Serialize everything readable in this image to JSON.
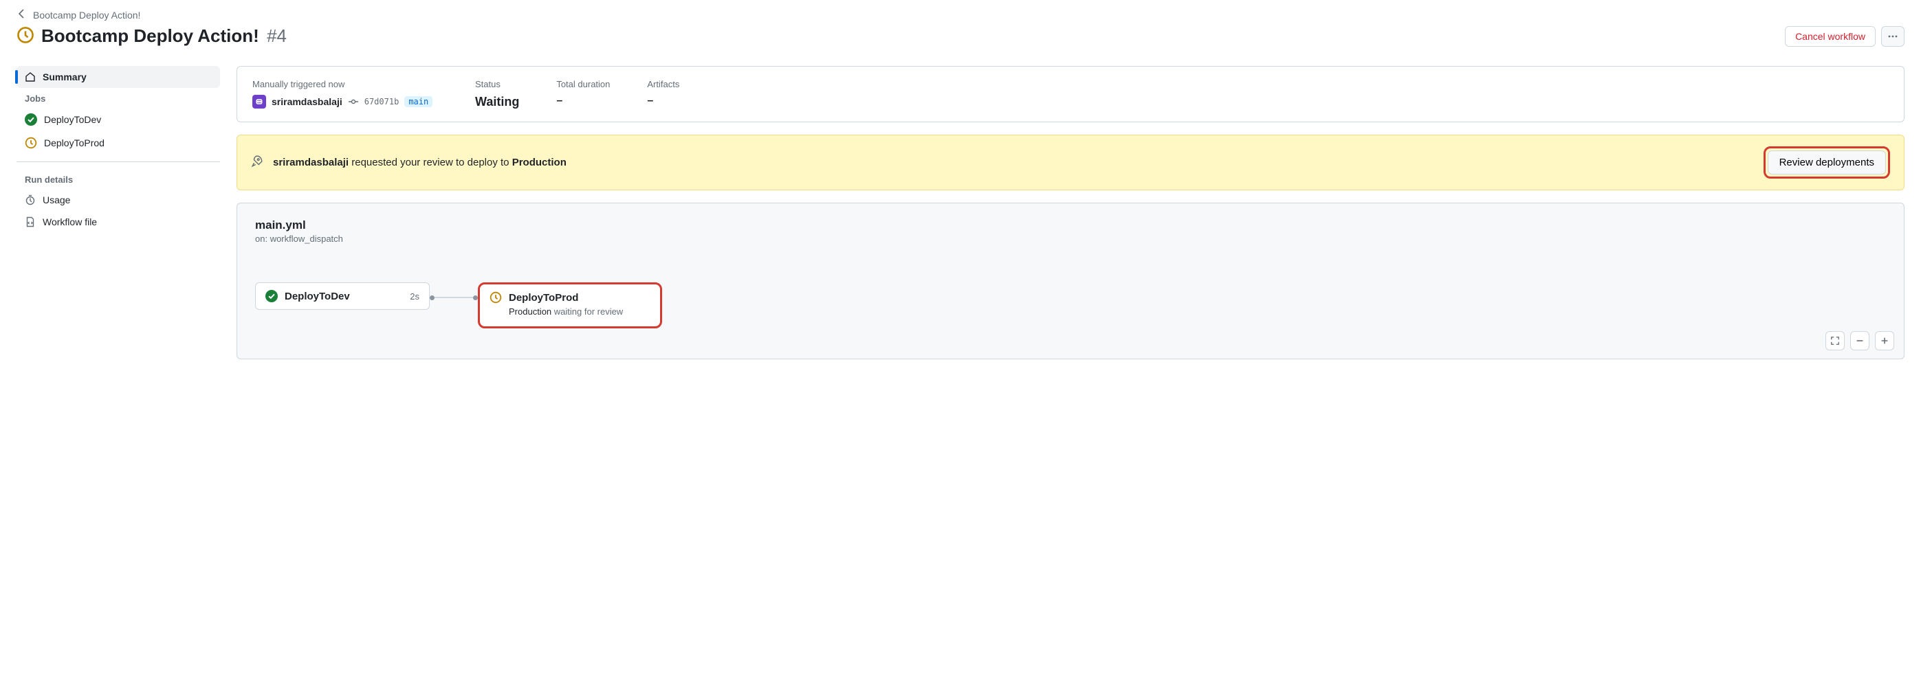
{
  "breadcrumb": {
    "text": "Bootcamp Deploy Action!"
  },
  "title": {
    "name": "Bootcamp Deploy Action!",
    "run_number": "#4"
  },
  "actions": {
    "cancel": "Cancel workflow"
  },
  "sidebar": {
    "summary": "Summary",
    "jobs_header": "Jobs",
    "jobs": [
      {
        "name": "DeployToDev",
        "status": "success"
      },
      {
        "name": "DeployToProd",
        "status": "waiting"
      }
    ],
    "run_details_header": "Run details",
    "usage": "Usage",
    "workflow_file": "Workflow file"
  },
  "summary": {
    "trigger_label": "Manually triggered now",
    "actor": "sriramdasbalaji",
    "commit": "67d071b",
    "branch": "main",
    "status_label": "Status",
    "status_value": "Waiting",
    "duration_label": "Total duration",
    "duration_value": "–",
    "artifacts_label": "Artifacts",
    "artifacts_value": "–"
  },
  "banner": {
    "actor": "sriramdasbalaji",
    "middle": " requested your review to deploy to ",
    "env": "Production",
    "button": "Review deployments"
  },
  "workflow": {
    "file": "main.yml",
    "on_prefix": "on: ",
    "on_event": "workflow_dispatch",
    "job1": {
      "name": "DeployToDev",
      "duration": "2s"
    },
    "job2": {
      "name": "DeployToProd",
      "env": "Production",
      "state": " waiting for review"
    }
  }
}
